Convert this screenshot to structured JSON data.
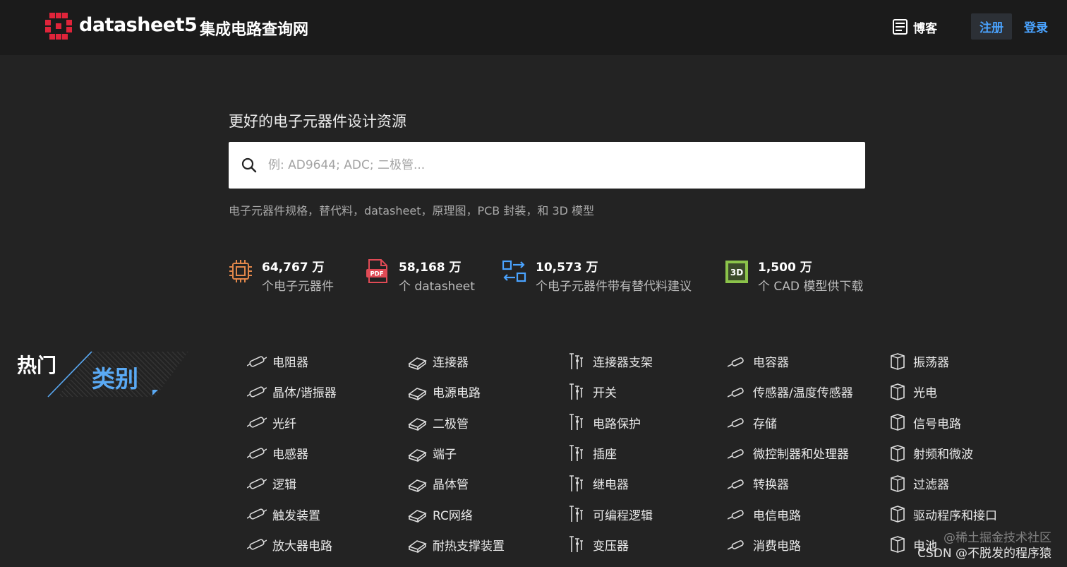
{
  "header": {
    "logo_text": "datasheet5",
    "logo_sub": "集成电路查询网",
    "blog_label": "博客",
    "register_label": "注册",
    "login_label": "登录",
    "accent_color": "#4aa3ff",
    "logo_color": "#e0243a"
  },
  "hero": {
    "tagline": "更好的电子元器件设计资源",
    "search_placeholder": "例: AD9644; ADC; 二极管...",
    "subtag": "电子元器件规格，替代料，datasheet，原理图，PCB 封装，和 3D 模型"
  },
  "stats": [
    {
      "icon": "chip-icon",
      "number": "64,767 万",
      "desc": "个电子元器件",
      "color": "#e2874a"
    },
    {
      "icon": "pdf-icon",
      "number": "58,168 万",
      "desc": "个 datasheet",
      "color": "#e04a55"
    },
    {
      "icon": "swap-icon",
      "number": "10,573 万",
      "desc": "个电子元器件带有替代料建议",
      "color": "#4aa3ff"
    },
    {
      "icon": "3d-icon",
      "number": "1,500 万",
      "desc": "个 CAD 模型供下载",
      "color": "#8bc34a"
    }
  ],
  "categories_heading": {
    "part1": "热门",
    "part2": "类别"
  },
  "categories": [
    {
      "label": "电阻器",
      "icon": "resistor-icon"
    },
    {
      "label": "连接器",
      "icon": "connector-icon"
    },
    {
      "label": "连接器支架",
      "icon": "connector-bracket-icon"
    },
    {
      "label": "电容器",
      "icon": "capacitor-icon"
    },
    {
      "label": "振荡器",
      "icon": "oscillator-icon"
    },
    {
      "label": "晶体/谐振器",
      "icon": "crystal-icon"
    },
    {
      "label": "电源电路",
      "icon": "power-circuit-icon"
    },
    {
      "label": "开关",
      "icon": "switch-icon"
    },
    {
      "label": "传感器/温度传感器",
      "icon": "sensor-icon"
    },
    {
      "label": "光电",
      "icon": "optoelectronic-icon"
    },
    {
      "label": "光纤",
      "icon": "fiber-icon"
    },
    {
      "label": "二极管",
      "icon": "diode-icon"
    },
    {
      "label": "电路保护",
      "icon": "circuit-protection-icon"
    },
    {
      "label": "存储",
      "icon": "memory-icon"
    },
    {
      "label": "信号电路",
      "icon": "signal-circuit-icon"
    },
    {
      "label": "电感器",
      "icon": "inductor-icon"
    },
    {
      "label": "端子",
      "icon": "terminal-icon"
    },
    {
      "label": "插座",
      "icon": "socket-icon"
    },
    {
      "label": "微控制器和处理器",
      "icon": "mcu-icon"
    },
    {
      "label": "射频和微波",
      "icon": "rf-icon"
    },
    {
      "label": "逻辑",
      "icon": "logic-icon"
    },
    {
      "label": "晶体管",
      "icon": "transistor-icon"
    },
    {
      "label": "继电器",
      "icon": "relay-icon"
    },
    {
      "label": "转换器",
      "icon": "converter-icon"
    },
    {
      "label": "过滤器",
      "icon": "filter-icon"
    },
    {
      "label": "触发装置",
      "icon": "trigger-icon"
    },
    {
      "label": "RC网络",
      "icon": "rc-network-icon"
    },
    {
      "label": "可编程逻辑",
      "icon": "programmable-logic-icon"
    },
    {
      "label": "电信电路",
      "icon": "telecom-icon"
    },
    {
      "label": "驱动程序和接口",
      "icon": "driver-icon"
    },
    {
      "label": "放大器电路",
      "icon": "amplifier-icon"
    },
    {
      "label": "耐热支撑装置",
      "icon": "heat-support-icon"
    },
    {
      "label": "变压器",
      "icon": "transformer-icon"
    },
    {
      "label": "消费电路",
      "icon": "consumer-circuit-icon"
    },
    {
      "label": "电池",
      "icon": "battery-icon"
    }
  ],
  "watermark": {
    "line1": "@稀土掘金技术社区",
    "line2": "CSDN @不脱发的程序猿"
  }
}
